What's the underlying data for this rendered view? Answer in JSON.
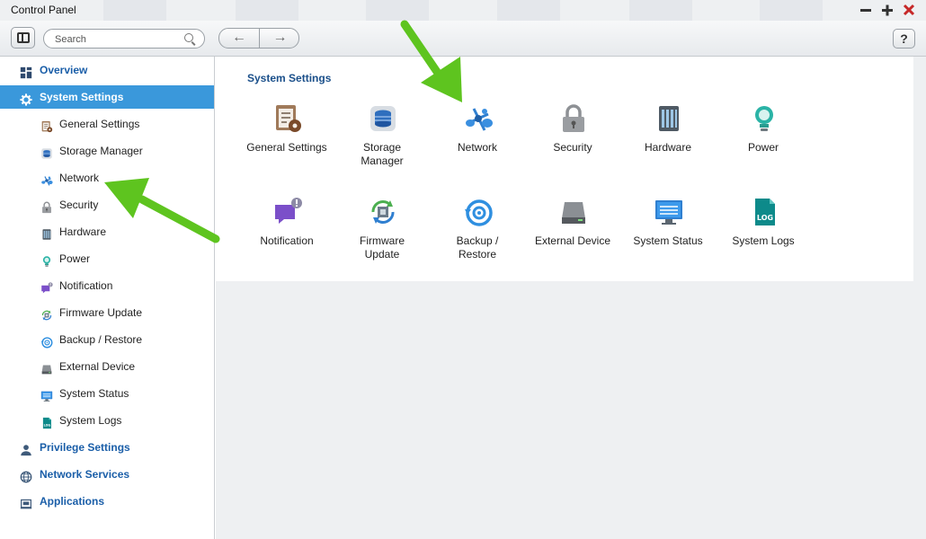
{
  "window": {
    "title": "Control Panel",
    "controls": [
      "minimize",
      "maximize",
      "close"
    ]
  },
  "toolbar": {
    "search_placeholder": "Search",
    "back_glyph": "←",
    "forward_glyph": "→",
    "help_label": "?"
  },
  "sidebar": {
    "items": [
      {
        "label": "Overview",
        "icon": "overview-icon",
        "level": "top"
      },
      {
        "label": "System Settings",
        "icon": "gear-icon",
        "level": "top",
        "active": true
      },
      {
        "label": "General Settings",
        "icon": "general-settings-icon",
        "level": "sub"
      },
      {
        "label": "Storage Manager",
        "icon": "storage-icon",
        "level": "sub"
      },
      {
        "label": "Network",
        "icon": "network-icon",
        "level": "sub"
      },
      {
        "label": "Security",
        "icon": "lock-icon",
        "level": "sub"
      },
      {
        "label": "Hardware",
        "icon": "hardware-icon",
        "level": "sub"
      },
      {
        "label": "Power",
        "icon": "power-bulb-icon",
        "level": "sub"
      },
      {
        "label": "Notification",
        "icon": "notification-icon",
        "level": "sub"
      },
      {
        "label": "Firmware Update",
        "icon": "firmware-icon",
        "level": "sub"
      },
      {
        "label": "Backup / Restore",
        "icon": "backup-icon",
        "level": "sub"
      },
      {
        "label": "External Device",
        "icon": "external-device-icon",
        "level": "sub"
      },
      {
        "label": "System Status",
        "icon": "monitor-icon",
        "level": "sub"
      },
      {
        "label": "System Logs",
        "icon": "log-icon",
        "level": "sub"
      },
      {
        "label": "Privilege Settings",
        "icon": "user-icon",
        "level": "top"
      },
      {
        "label": "Network Services",
        "icon": "globe-icon",
        "level": "top"
      },
      {
        "label": "Applications",
        "icon": "applications-icon",
        "level": "top"
      }
    ]
  },
  "main": {
    "section_title": "System Settings",
    "tiles": [
      {
        "label": "General Settings",
        "icon": "general-settings-icon"
      },
      {
        "label": "Storage Manager",
        "icon": "storage-icon"
      },
      {
        "label": "Network",
        "icon": "network-icon"
      },
      {
        "label": "Security",
        "icon": "lock-icon"
      },
      {
        "label": "Hardware",
        "icon": "hardware-icon"
      },
      {
        "label": "Power",
        "icon": "power-bulb-icon"
      },
      {
        "label": "Notification",
        "icon": "notification-icon"
      },
      {
        "label": "Firmware Update",
        "icon": "firmware-icon"
      },
      {
        "label": "Backup / Restore",
        "icon": "backup-icon"
      },
      {
        "label": "External Device",
        "icon": "external-device-icon"
      },
      {
        "label": "System Status",
        "icon": "monitor-icon"
      },
      {
        "label": "System Logs",
        "icon": "log-icon"
      }
    ]
  },
  "colors": {
    "accent": "#3a98db",
    "nav_text": "#1a5ea8",
    "annotation_arrow": "#5ec41f"
  }
}
